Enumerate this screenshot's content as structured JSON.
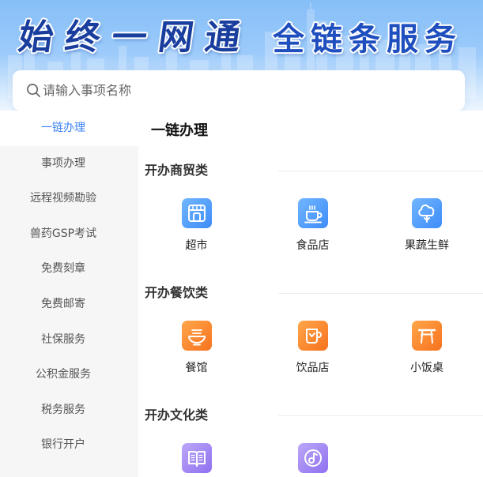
{
  "banner": {
    "title_left": "始终一网通",
    "title_right": "全链条服务"
  },
  "search": {
    "icon": "search-icon",
    "placeholder": "请输入事项名称"
  },
  "sidebar": {
    "items": [
      {
        "label": "一链办理",
        "active": true
      },
      {
        "label": "事项办理"
      },
      {
        "label": "远程视频勘验"
      },
      {
        "label": "兽药GSP考试"
      },
      {
        "label": "免费刻章"
      },
      {
        "label": "免费邮寄"
      },
      {
        "label": "社保服务"
      },
      {
        "label": "公积金服务"
      },
      {
        "label": "税务服务"
      },
      {
        "label": "银行开户"
      }
    ]
  },
  "main": {
    "heading": "一链办理",
    "sections": [
      {
        "title": "开办商贸类",
        "items": [
          {
            "label": "超市",
            "icon": "store-icon"
          },
          {
            "label": "食品店",
            "icon": "coffee-cup-icon"
          },
          {
            "label": "果蔬生鲜",
            "icon": "broccoli-icon"
          }
        ]
      },
      {
        "title": "开办餐饮类",
        "items": [
          {
            "label": "餐馆",
            "icon": "noodle-bowl-icon"
          },
          {
            "label": "饮品店",
            "icon": "drink-cup-icon"
          },
          {
            "label": "小饭桌",
            "icon": "table-icon"
          }
        ]
      },
      {
        "title": "开办文化类",
        "items": [
          {
            "icon": "book-icon"
          },
          {
            "icon": "music-disc-icon"
          }
        ]
      }
    ]
  },
  "colors": {
    "accent": "#3a80f5",
    "sidebar_bg": "#f6f6f6",
    "banner_sky": "#86bff8",
    "title_dark_blue": "#1a3e9e",
    "icon_blue": [
      "#72b6ff",
      "#3d8cf8"
    ],
    "icon_orange": [
      "#ffa64a",
      "#f7721e"
    ],
    "icon_purple": [
      "#bca7f8",
      "#8e70f0"
    ]
  }
}
